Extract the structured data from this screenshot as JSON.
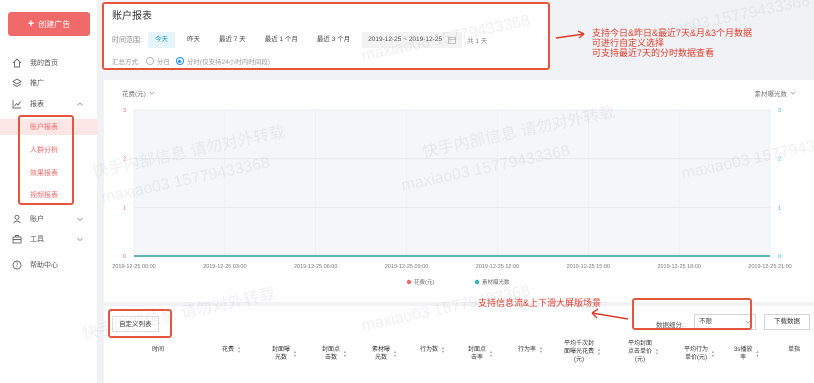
{
  "sidebar": {
    "create_label": "创建广告",
    "items": [
      {
        "label": "我的首页",
        "icon": "home-icon"
      },
      {
        "label": "推广",
        "icon": "layers-icon"
      },
      {
        "label": "报表",
        "icon": "chart-icon"
      },
      {
        "label": "账户",
        "icon": "user-icon"
      },
      {
        "label": "工具",
        "icon": "toolbox-icon"
      },
      {
        "label": "帮助中心",
        "icon": "help-icon"
      }
    ],
    "report_sub": [
      "账户报表",
      "人群分析",
      "效果报表",
      "视频报表"
    ]
  },
  "top_panel": {
    "title": "账户报表",
    "time_range_label": "时间范围:",
    "range_buttons": [
      "今天",
      "昨天",
      "最近 7 天",
      "最近 1 个月",
      "最近 3 个月"
    ],
    "active_range": "今天",
    "date_range": "2019-12-25  ~  2019-12-25",
    "day_count": "共 1 天",
    "summary_label": "汇总方式:",
    "summary_options": [
      "分日",
      "分时(仅支持24小时内时间段)"
    ],
    "summary_selected": "分时(仅支持24小时内时间段)"
  },
  "annotations": {
    "top": [
      "支持今日&昨日&最近7天&月&3个月数据",
      "可进行自定义选择",
      "可支持最近7天的分时数据查看"
    ],
    "bottom": "支持信息流&上下滑大屏版场景"
  },
  "watermark": {
    "line1": "快手内部信息 请勿对外转载",
    "line2": "maxiao03 15779433368"
  },
  "chart_data": {
    "type": "line",
    "left_selector": "花费(元)",
    "right_selector": "素材曝光数",
    "x": [
      "2019-12-25 00:00",
      "2019-12-25 03:00",
      "2019-12-25 06:00",
      "2019-12-25 09:00",
      "2019-12-25 12:00",
      "2019-12-25 15:00",
      "2019-12-25 18:00",
      "2019-12-25 21:00"
    ],
    "y_ticks": [
      0,
      1,
      2,
      3
    ],
    "ylim": [
      0,
      3
    ],
    "series": [
      {
        "name": "花费(元)",
        "color": "#f06a6a",
        "values": [
          0,
          0,
          0,
          0,
          0,
          0,
          0,
          0
        ]
      },
      {
        "name": "素材曝光数",
        "color": "#2fb5b8",
        "values": [
          0,
          0,
          0,
          0,
          0,
          0,
          0,
          0
        ]
      }
    ],
    "grid": true,
    "legend": "bottom"
  },
  "table": {
    "custom_columns_label": "自定义列表",
    "detail_label": "数据细分:",
    "detail_value": "不限",
    "download_label": "下载数据",
    "headers": [
      "时间",
      "花费",
      "封面曝\n光数",
      "封面点\n击数",
      "素材曝\n光数",
      "行为数",
      "封面点\n击率",
      "行为率",
      "平均千次封\n面曝光花费\n(元)",
      "平均封面\n点击单价\n(元)",
      "平均行为\n单价(元)",
      "3s播放\n率",
      "单指"
    ]
  }
}
